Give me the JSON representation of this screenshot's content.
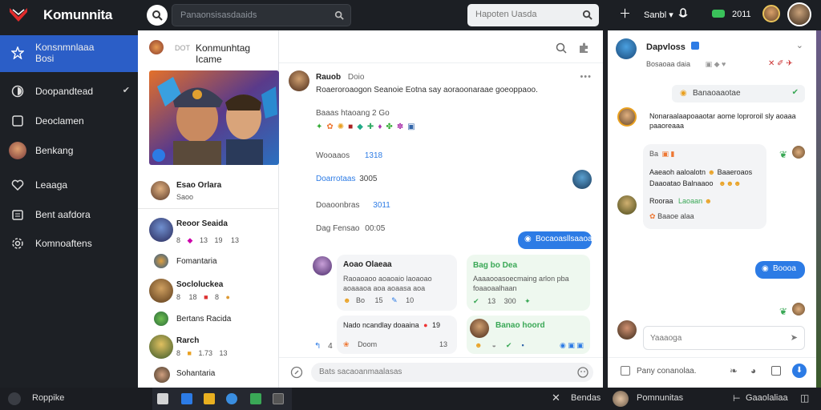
{
  "app": {
    "brand": "Komunnita"
  },
  "topbar": {
    "search_placeholder": "Panaonsisasdaaids",
    "search2_placeholder": "Hapoten Uasda",
    "add_icon": "plus-icon",
    "user_text": "Sanbl",
    "mic_icon": "mic-icon",
    "status_value": "2011"
  },
  "sidebar": {
    "items": [
      {
        "label": "Konsnmnlaaa",
        "sub": "Bosi",
        "icon": "star-icon"
      },
      {
        "label": "Doopandtead",
        "icon": "shield-icon"
      },
      {
        "label": "Deoclamen",
        "icon": "square-icon"
      },
      {
        "label": "Benkang",
        "icon": "avatar-icon"
      },
      {
        "label": "Leaaga",
        "icon": "heart-icon"
      },
      {
        "label": "Bent aafdora",
        "icon": "calendar-icon"
      },
      {
        "label": "Komnoaftens",
        "icon": "settings-icon"
      }
    ]
  },
  "cards": {
    "header_badge": "DOT",
    "header_title": "Konmunhtag Icame",
    "items": [
      {
        "name": "Esao Orlara",
        "sub": "Saoo"
      },
      {
        "name": "Reoor Seaida",
        "meta": [
          "8",
          "13",
          "19",
          "13"
        ]
      },
      {
        "name": "Fomantaria"
      },
      {
        "name": "Socloluckea",
        "meta": [
          "8",
          "18",
          "8"
        ]
      },
      {
        "name": "Bertans Racida"
      },
      {
        "name": "Rarch",
        "meta": [
          "8",
          "1.73",
          "13"
        ]
      },
      {
        "name": "Sohantaria"
      }
    ]
  },
  "main": {
    "post_author": "Rauob",
    "post_author_sub": "Doio",
    "post_text": "Roaeroroaogon Seanoie Eotna say aoraoonaraae goeoppaoo.",
    "section1": "Baaas htaoang 2 Go",
    "line1_label": "Wooaaos",
    "line1_value": "1318",
    "line2_label": "Doarrotaas",
    "line2_value": "3005",
    "line3_label": "Doaoonbras",
    "line3_value": "3011",
    "line4_label": "Dag Fensao",
    "line4_value": "00:05",
    "reply_pill": "Bocaoasllsaaoa",
    "card1_name": "Aoao Olaeaa",
    "card1_text": "Raoaoaoo aoaoaio laoaoao aoaaaoa aoa aoaasa aoa",
    "card1_meta": [
      "Bo",
      "15",
      "10"
    ],
    "card2_title": "Bag bo Dea",
    "card2_text": "Aaaaooasoecmaing arlon pba foaaoaalhaan",
    "card2_meta": [
      "13",
      "300"
    ],
    "card3_text": "Nado ncandlay doaaina",
    "card3_value": "19",
    "card3_meta": [
      "4",
      "Doom",
      "13"
    ],
    "card4_title": "Banao hoord",
    "composer_placeholder": "Bats sacaoanmaalasas"
  },
  "chat": {
    "contact_name": "Dapvloss",
    "contact_sub": "Bosaoaa daia",
    "pill1": "Banaoaaotae",
    "msg1": "Nonaraalaapoaaotar aome loproroil sly aoaaa paaoreaaa",
    "msg2_head": "Ba",
    "msg2_line1": "Aaeaoh aaloalotn",
    "msg2_line1b": "Baaeroaos",
    "msg2_line2": "Daaoatao Balnaaoo",
    "msg2_line3": "Rooraa",
    "msg2_line3b": "Laoaan",
    "msg2_line4": "Baaoe alaa",
    "pill2": "Boooa",
    "input_placeholder": "Yaaaoga",
    "footer_placeholder": "Pany conanolaa."
  },
  "taskbar": {
    "start": "Roppike",
    "close_label": "Bendas",
    "app_label": "Pomnunitas",
    "notif_label": "Gaaolaliaa"
  },
  "colors": {
    "accent": "#2c7be5",
    "sidebar_active": "#2b5ec7",
    "green": "#3aa856"
  }
}
